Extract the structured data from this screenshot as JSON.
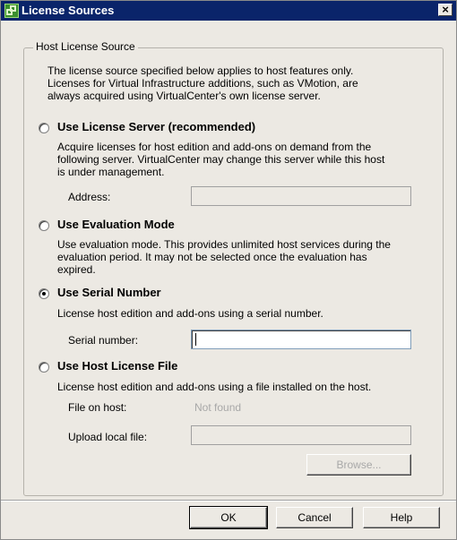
{
  "window": {
    "title": "License Sources"
  },
  "group": {
    "legend": "Host License Source",
    "intro": [
      "The license source specified below applies to host features only.",
      "Licenses for Virtual Infrastructure additions, such as VMotion, are",
      "always acquired using VirtualCenter's own license server."
    ]
  },
  "options": {
    "license_server": {
      "label": "Use License Server (recommended)",
      "description": [
        "Acquire licenses for host edition and add-ons on demand from the",
        "following server. VirtualCenter may change this server while this host",
        "is under management."
      ],
      "address_label": "Address:",
      "address_value": ""
    },
    "evaluation": {
      "label": "Use Evaluation Mode",
      "description": [
        "Use evaluation mode. This provides unlimited host services during the",
        "evaluation period. It may not be selected once the evaluation has",
        "expired."
      ]
    },
    "serial": {
      "label": "Use Serial Number",
      "description": "License host edition and add-ons using a serial number.",
      "serial_label": "Serial number:",
      "serial_value": ""
    },
    "host_file": {
      "label": "Use Host License File",
      "description": "License host edition and add-ons using a file installed on the host.",
      "file_label": "File on host:",
      "file_value": "Not found",
      "upload_label": "Upload local file:",
      "upload_value": "",
      "browse_label": "Browse..."
    }
  },
  "selected_option": "serial",
  "buttons": {
    "ok": "OK",
    "cancel": "Cancel",
    "help": "Help"
  },
  "colors": {
    "titlebar": "#0a246a",
    "dialog_bg": "#ece9e3",
    "disabled_text": "#a8a8a8"
  }
}
